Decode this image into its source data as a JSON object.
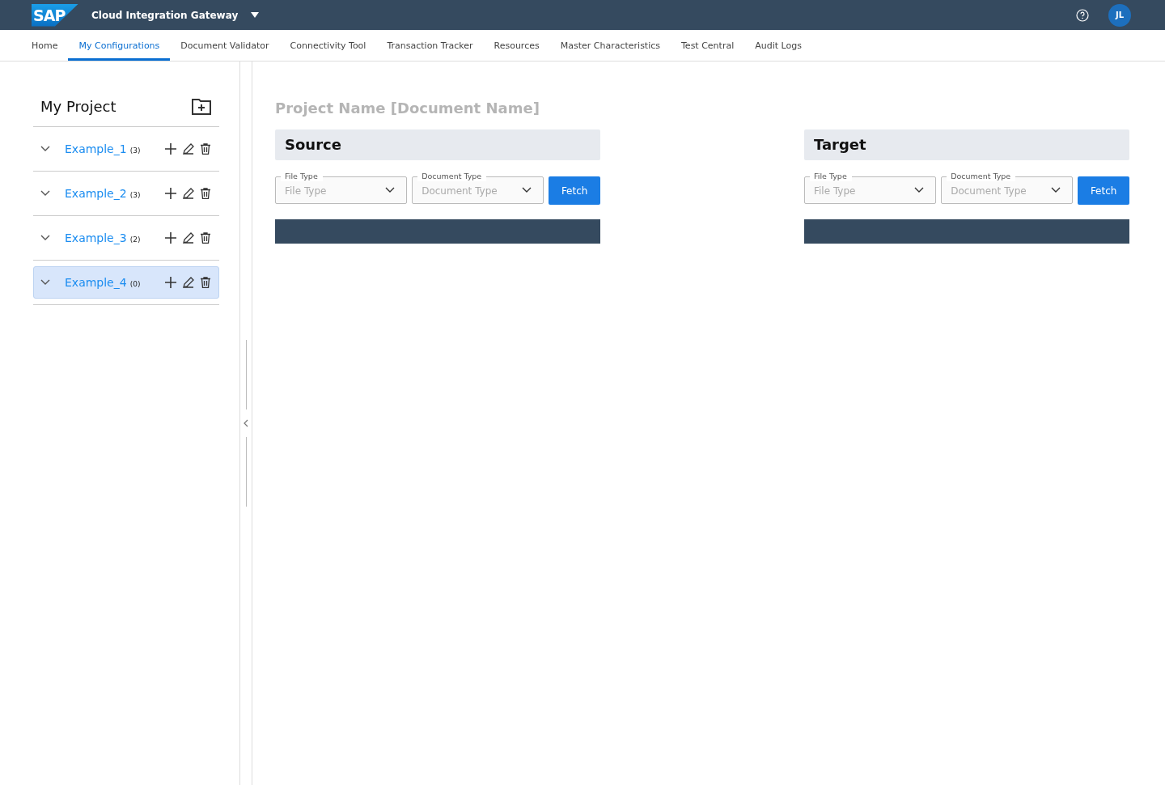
{
  "shell": {
    "logo": "SAP",
    "title": "Cloud Integration Gateway",
    "avatar": "JL"
  },
  "tabs": [
    {
      "label": "Home",
      "selected": false
    },
    {
      "label": "My Configurations",
      "selected": true
    },
    {
      "label": "Document Validator",
      "selected": false
    },
    {
      "label": "Connectivity Tool",
      "selected": false
    },
    {
      "label": "Transaction Tracker",
      "selected": false
    },
    {
      "label": "Resources",
      "selected": false
    },
    {
      "label": "Master Characteristics",
      "selected": false
    },
    {
      "label": "Test Central",
      "selected": false
    },
    {
      "label": "Audit Logs",
      "selected": false
    }
  ],
  "sidebar": {
    "title": "My Project",
    "items": [
      {
        "name": "Example_1",
        "count": "(3)",
        "selected": false
      },
      {
        "name": "Example_2",
        "count": "(3)",
        "selected": false
      },
      {
        "name": "Example_3",
        "count": "(2)",
        "selected": false
      },
      {
        "name": "Example_4",
        "count": "(0)",
        "selected": true
      }
    ]
  },
  "document_title": "Project Name [Document Name]",
  "panels": [
    {
      "heading": "Source",
      "fields": [
        {
          "label": "File Type",
          "placeholder": "File Type"
        },
        {
          "label": "Document Type",
          "placeholder": "Document Type"
        }
      ],
      "button": "Fetch"
    },
    {
      "heading": "Target",
      "fields": [
        {
          "label": "File Type",
          "placeholder": "File Type"
        },
        {
          "label": "Document Type",
          "placeholder": "Document Type"
        }
      ],
      "button": "Fetch"
    }
  ]
}
